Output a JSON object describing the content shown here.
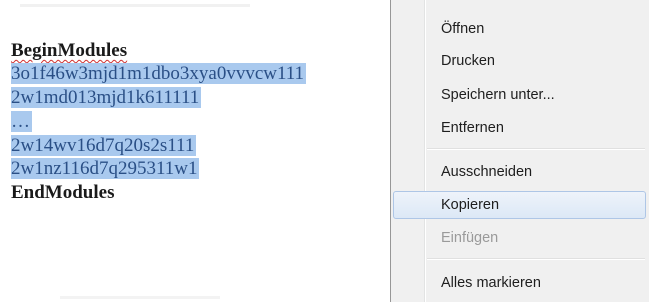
{
  "document": {
    "lines": [
      "BeginModules",
      "3o1f46w3mjd1m1dbo3xya0vvvcw111",
      "2w1md013mjd1k611111",
      "…",
      "2w14wv16d7q20s2s111",
      "2w1nz116d7q295311w1",
      "EndModules"
    ]
  },
  "context_menu": {
    "items": [
      {
        "label": "Öffnen",
        "state": "normal"
      },
      {
        "label": "Drucken",
        "state": "normal"
      },
      {
        "label": "Speichern unter...",
        "state": "normal"
      },
      {
        "label": "Entfernen",
        "state": "normal"
      },
      {
        "label": "Ausschneiden",
        "state": "normal"
      },
      {
        "label": "Kopieren",
        "state": "highlighted"
      },
      {
        "label": "Einfügen",
        "state": "disabled"
      },
      {
        "label": "Alles markieren",
        "state": "normal"
      }
    ]
  },
  "colors": {
    "selection": "#a9c9ee",
    "selected_text": "#2a4f86",
    "menu_background": "#f0f0f0",
    "menu_highlight": "#dce8f6",
    "disabled_text": "#9a9a9a"
  }
}
